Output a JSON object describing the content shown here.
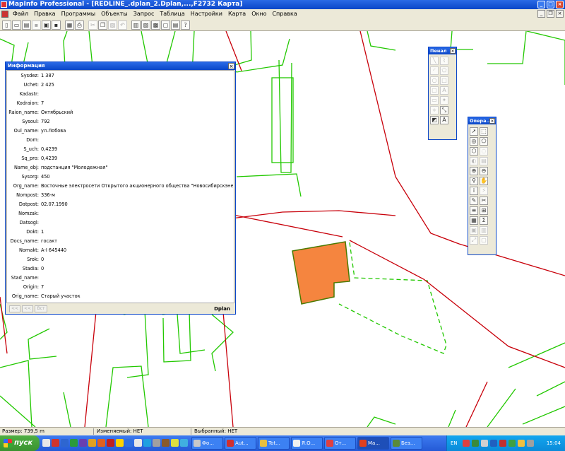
{
  "window": {
    "title": "MapInfo Professional - [REDLINE_.dplan_2.Dplan,...,F2732 Карта]"
  },
  "menu": {
    "items": [
      "Файл",
      "Правка",
      "Программы",
      "Объекты",
      "Запрос",
      "Таблица",
      "Настройки",
      "Карта",
      "Окно",
      "Справка"
    ]
  },
  "toolbar": {
    "icons": [
      "new-icon",
      "open-icon",
      "open-table-icon",
      "save-icon",
      "save-workspace-icon",
      "save-as-icon",
      "table-icon",
      "print-icon",
      "cut-icon",
      "copy-icon",
      "paste-icon",
      "undo-icon",
      "new-browser-icon",
      "new-mapper-icon",
      "new-grapher-icon",
      "new-layout-icon",
      "redistrict-icon",
      "help-pointer-icon"
    ]
  },
  "info_window": {
    "title": "Информация",
    "fields": [
      {
        "key": "Sysdez:",
        "value": "1 387"
      },
      {
        "key": "Uchet:",
        "value": "2 425"
      },
      {
        "key": "Kadastr:",
        "value": ""
      },
      {
        "key": "Kodraion:",
        "value": "7"
      },
      {
        "key": "Raion_name:",
        "value": "Октябрьский"
      },
      {
        "key": "Sysoul:",
        "value": "792"
      },
      {
        "key": "Oul_name:",
        "value": "ул.Лобова"
      },
      {
        "key": "Dom:",
        "value": ""
      },
      {
        "key": "S_uch:",
        "value": "0,4239"
      },
      {
        "key": "Sq_pro:",
        "value": "0,4239"
      },
      {
        "key": "Name_obj:",
        "value": "подстанция \"Молодежная\""
      },
      {
        "key": "Sysorg:",
        "value": "450"
      },
      {
        "key": "Org_name:",
        "value": "Восточные электросети Открытого акционерного общества \"Новосибирскэнерго\""
      },
      {
        "key": "Nompost:",
        "value": "336-м"
      },
      {
        "key": "Datpost:",
        "value": "02.07.1990"
      },
      {
        "key": "Nomzak:",
        "value": ""
      },
      {
        "key": "Datsogl:",
        "value": ""
      },
      {
        "key": "Dokt:",
        "value": "1"
      },
      {
        "key": "Docs_name:",
        "value": "госакт"
      },
      {
        "key": "Nomakt:",
        "value": "А-I 645440"
      },
      {
        "key": "Srok:",
        "value": "0"
      },
      {
        "key": "Stadia:",
        "value": "0"
      },
      {
        "key": "Stad_name:",
        "value": ""
      },
      {
        "key": "Origin:",
        "value": "7"
      },
      {
        "key": "Orig_name:",
        "value": "Старый участок"
      }
    ],
    "nav": [
      "<<",
      "<<",
      "Вст"
    ],
    "table_label": "Dplan"
  },
  "drawing_palette": {
    "title": "Пенал"
  },
  "main_palette": {
    "title": "Опера..."
  },
  "map": {
    "colors": {
      "parcel_line": "#c8000a",
      "building_line": "#22c800",
      "selected_fill": "#f5853f",
      "selected_border": "#4a7a00"
    }
  },
  "status": {
    "zoom": "Размер: 739,5 m",
    "editable": "Изменяемый: НЕТ",
    "selectable": "Выбранный: НЕТ"
  },
  "taskbar": {
    "start_label": "пуск",
    "tasks": [
      "Фо...",
      "Aut...",
      "Tot...",
      "Я.О...",
      "От...",
      "Ma...",
      "Без..."
    ],
    "language": "EN",
    "clock": "15:04"
  }
}
